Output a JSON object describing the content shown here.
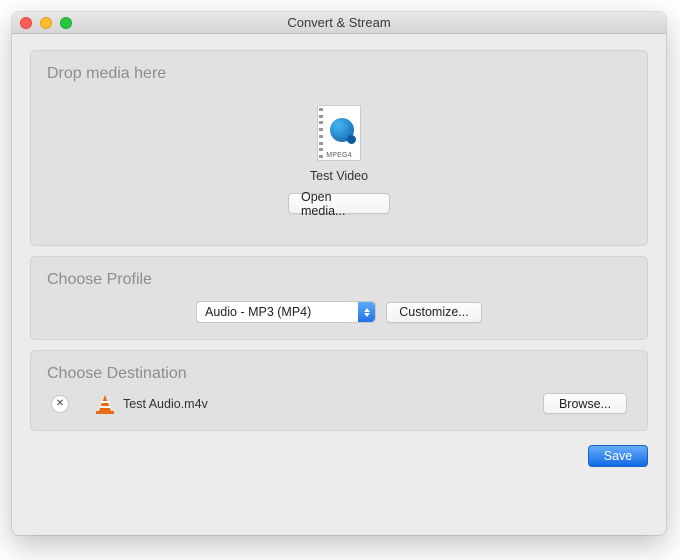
{
  "window": {
    "title": "Convert & Stream"
  },
  "drop": {
    "title": "Drop media here",
    "icon_format_label": "MPEG4",
    "media_name": "Test Video",
    "open_button": "Open media..."
  },
  "profile": {
    "title": "Choose Profile",
    "selected": "Audio - MP3 (MP4)",
    "customize_button": "Customize..."
  },
  "destination": {
    "title": "Choose Destination",
    "filename": "Test Audio.m4v",
    "browse_button": "Browse..."
  },
  "footer": {
    "save_button": "Save"
  }
}
